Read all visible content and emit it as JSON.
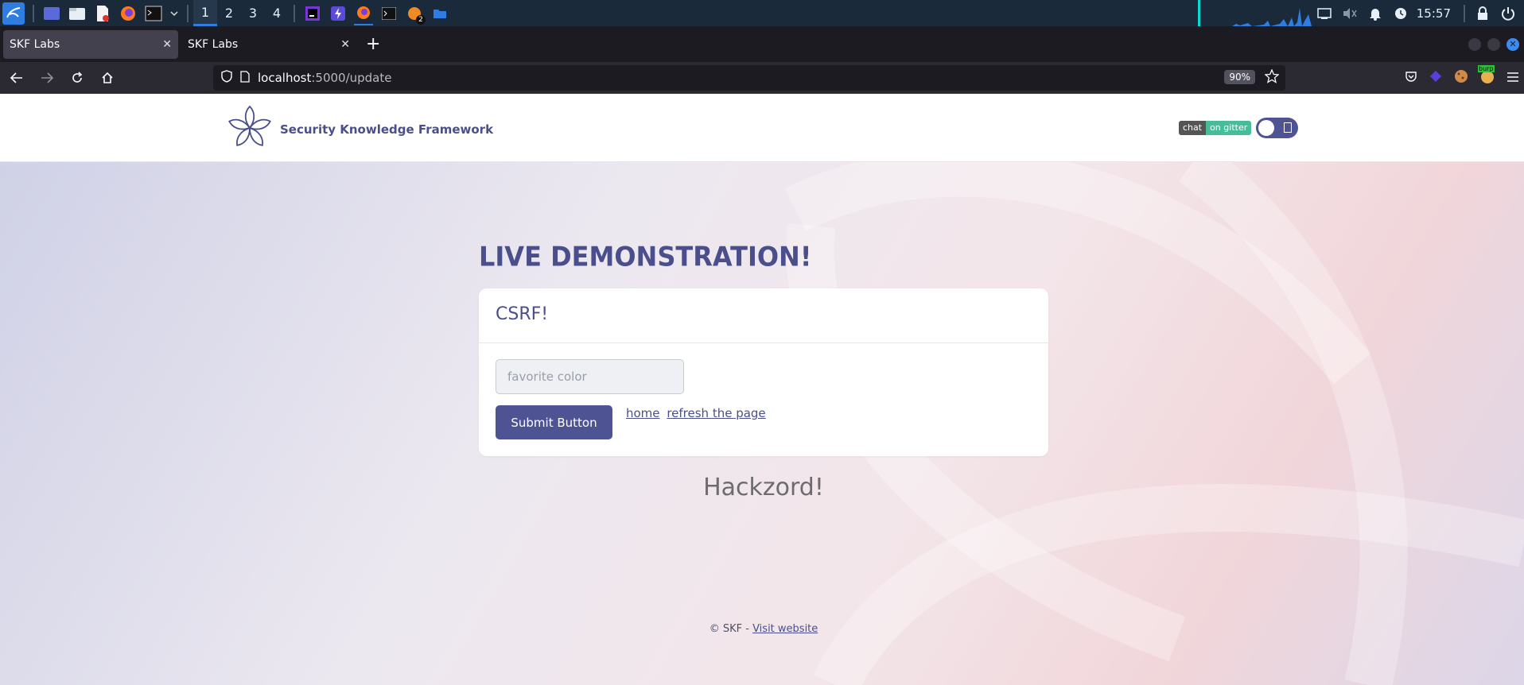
{
  "taskbar": {
    "workspaces": [
      "1",
      "2",
      "3",
      "4"
    ],
    "clock": "15:57",
    "notification_badge": "2",
    "accent": "#2f7de1"
  },
  "browser": {
    "tabs": [
      {
        "label": "SKF Labs"
      },
      {
        "label": "SKF Labs"
      }
    ],
    "url_host": "localhost",
    "url_path": ":5000/update",
    "zoom": "90%",
    "extension_badge": "burp"
  },
  "site": {
    "brand_name": "Security Knowledge Framework",
    "gitter_left": "chat",
    "gitter_right": "on gitter",
    "title": "LIVE DEMONSTRATION!",
    "card_title": "CSRF!",
    "input_placeholder": "favorite color",
    "submit_label": "Submit Button",
    "link_home": "home",
    "link_refresh": "refresh the page",
    "result_text": "Hackzord!",
    "footer_prefix": "© SKF -",
    "footer_link": "Visit website",
    "brand_color": "#4a4f8c",
    "button_color": "#4e5394"
  }
}
